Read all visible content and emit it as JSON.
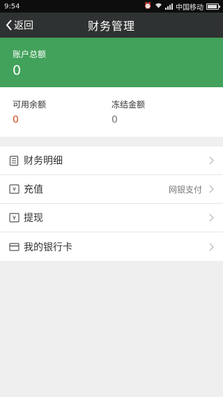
{
  "status_bar": {
    "time": "9:54",
    "carrier": "中国移动",
    "icons": [
      "alarm-icon",
      "wifi-icon",
      "signal-icon",
      "battery-icon"
    ]
  },
  "nav": {
    "back_label": "返回",
    "title": "财务管理"
  },
  "balance": {
    "label": "账户总额",
    "value": "0"
  },
  "sub_balances": {
    "available": {
      "label": "可用余额",
      "value": "0"
    },
    "frozen": {
      "label": "冻结金额",
      "value": "0"
    }
  },
  "menu": {
    "items": [
      {
        "label": "财务明细",
        "icon": "ledger-icon",
        "extra": ""
      },
      {
        "label": "充值",
        "icon": "yen-recharge-icon",
        "extra": "网银支付"
      },
      {
        "label": "提现",
        "icon": "yen-withdraw-icon",
        "extra": ""
      },
      {
        "label": "我的银行卡",
        "icon": "bank-card-icon",
        "extra": ""
      }
    ]
  },
  "colors": {
    "nav_bg": "#2f3232",
    "balance_bg": "#42a15a",
    "available_value": "#d4491c",
    "page_bg": "#efefef"
  }
}
